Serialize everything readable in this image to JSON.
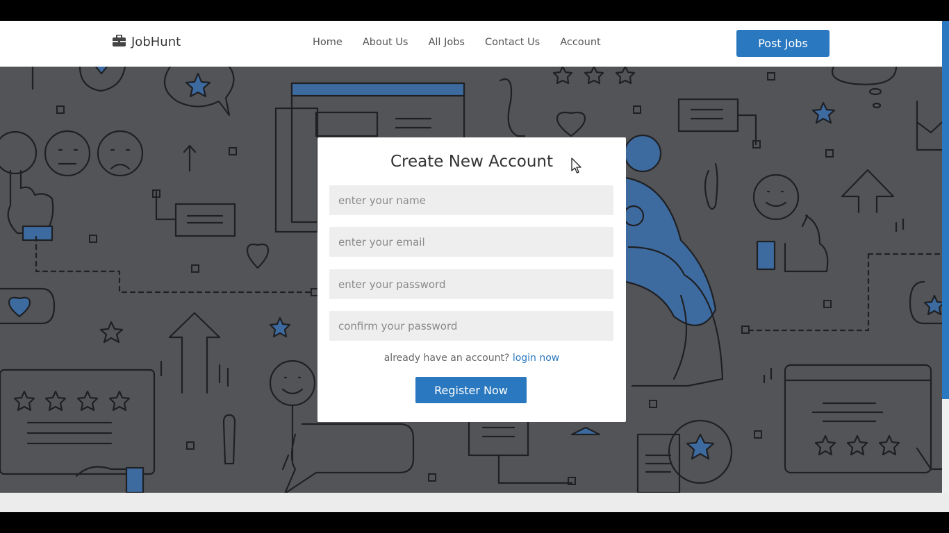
{
  "header": {
    "logo_text": "JobHunt",
    "nav": [
      "Home",
      "About Us",
      "All Jobs",
      "Contact Us",
      "Account"
    ],
    "post_jobs_label": "Post Jobs"
  },
  "modal": {
    "title": "Create New Account",
    "fields": [
      {
        "placeholder": "enter your name",
        "value": ""
      },
      {
        "placeholder": "enter your email",
        "value": ""
      },
      {
        "placeholder": "enter your password",
        "value": ""
      },
      {
        "placeholder": "confirm your password",
        "value": ""
      }
    ],
    "login_prompt": "already have an account?",
    "login_link": "login now",
    "register_label": "Register Now"
  },
  "colors": {
    "accent": "#2a78bf",
    "overlay": "#535457",
    "text": "#333333"
  },
  "icons": {
    "logo": "briefcase-icon",
    "cursor": "mouse-pointer-icon"
  }
}
